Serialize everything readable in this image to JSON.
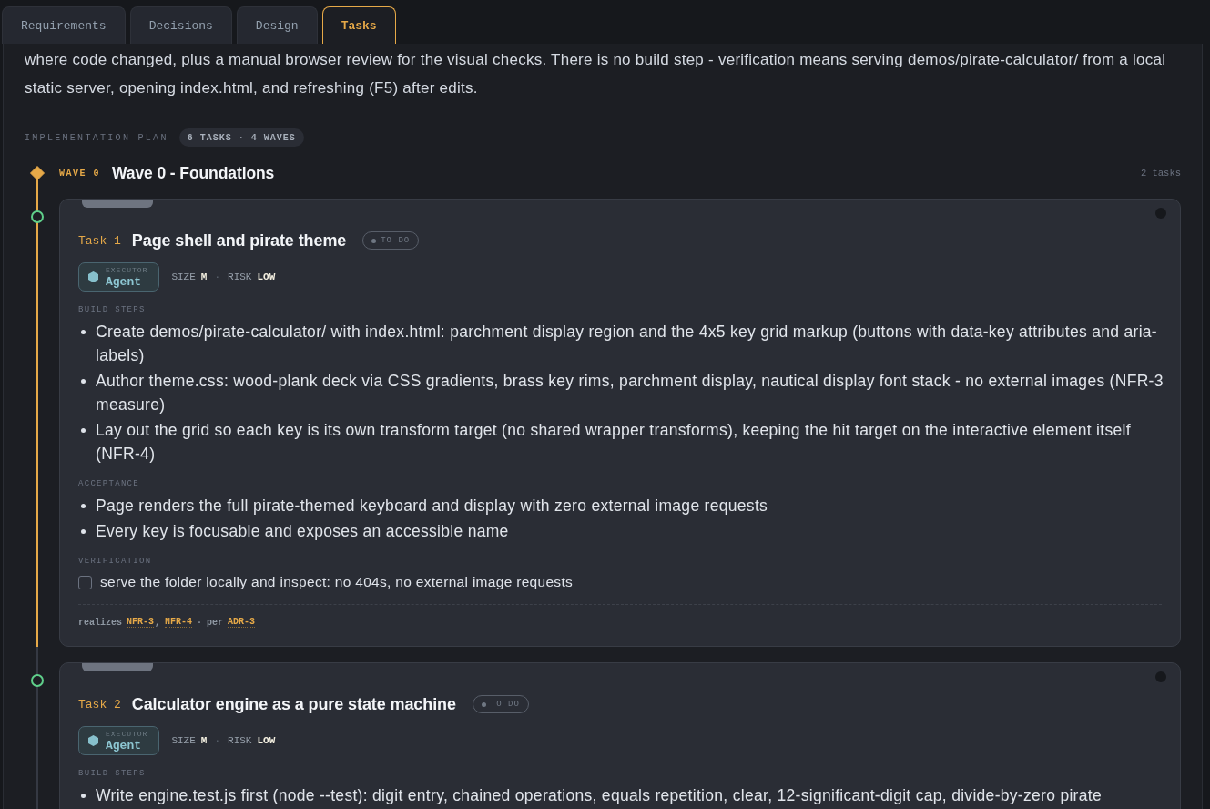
{
  "tabs": [
    {
      "label": "Requirements",
      "selected": false
    },
    {
      "label": "Decisions",
      "selected": false
    },
    {
      "label": "Design",
      "selected": false
    },
    {
      "label": "Tasks",
      "selected": true
    }
  ],
  "intro": "where code changed, plus a manual browser review for the visual checks. There is no build step - verification means serving demos/pirate-calculator/ from a local static server, opening index.html, and refreshing (F5) after edits.",
  "plan": {
    "heading": "IMPLEMENTATION PLAN",
    "summary": "6 TASKS · 4 WAVES"
  },
  "waves": [
    {
      "label": "WAVE 0",
      "title": "Wave 0 - Foundations",
      "count": "2 tasks",
      "tasks": [
        {
          "number": "Task 1",
          "title": "Page shell and pirate theme",
          "status": "TO DO",
          "done": false,
          "executor": {
            "label": "EXECUTOR",
            "value": "Agent"
          },
          "meta": [
            {
              "label": "SIZE",
              "value": "M"
            },
            {
              "label": "RISK",
              "value": "LOW"
            }
          ],
          "meta_separator": "·",
          "sections": [
            {
              "heading": "BUILD STEPS",
              "kind": "bullets",
              "items": [
                "Create demos/pirate-calculator/ with index.html: parchment display region and the 4x5 key grid markup (buttons with data-key attributes and aria-labels)",
                "Author theme.css: wood-plank deck via CSS gradients, brass key rims, parchment display, nautical display font stack - no external images (NFR-3 measure)",
                "Lay out the grid so each key is its own transform target (no shared wrapper transforms), keeping the hit target on the interactive element itself (NFR-4)"
              ]
            },
            {
              "heading": "ACCEPTANCE",
              "kind": "bullets",
              "items": [
                "Page renders the full pirate-themed keyboard and display with zero external image requests",
                "Every key is focusable and exposes an accessible name"
              ]
            },
            {
              "heading": "VERIFICATION",
              "kind": "checklist",
              "items": [
                {
                  "text": "serve the folder locally and inspect: no 404s, no external image requests",
                  "checked": false
                }
              ]
            }
          ],
          "footer": [
            {
              "kind": "text",
              "text": "realizes"
            },
            {
              "kind": "link",
              "text": "NFR-3"
            },
            {
              "kind": "comma",
              "text": ","
            },
            {
              "kind": "link",
              "text": "NFR-4"
            },
            {
              "kind": "text",
              "text": "·"
            },
            {
              "kind": "text",
              "text": "per"
            },
            {
              "kind": "link",
              "text": "ADR-3"
            }
          ]
        },
        {
          "number": "Task 2",
          "title": "Calculator engine as a pure state machine",
          "status": "TO DO",
          "done": false,
          "executor": {
            "label": "EXECUTOR",
            "value": "Agent"
          },
          "meta": [
            {
              "label": "SIZE",
              "value": "M"
            },
            {
              "label": "RISK",
              "value": "LOW"
            }
          ],
          "meta_separator": "·",
          "sections": [
            {
              "heading": "BUILD STEPS",
              "kind": "bullets",
              "items": [
                "Write engine.test.js first (node --test): digit entry, chained operations, equals repetition, clear, 12-significant-digit cap, divide-by-zero pirate"
              ]
            }
          ]
        }
      ]
    }
  ]
}
